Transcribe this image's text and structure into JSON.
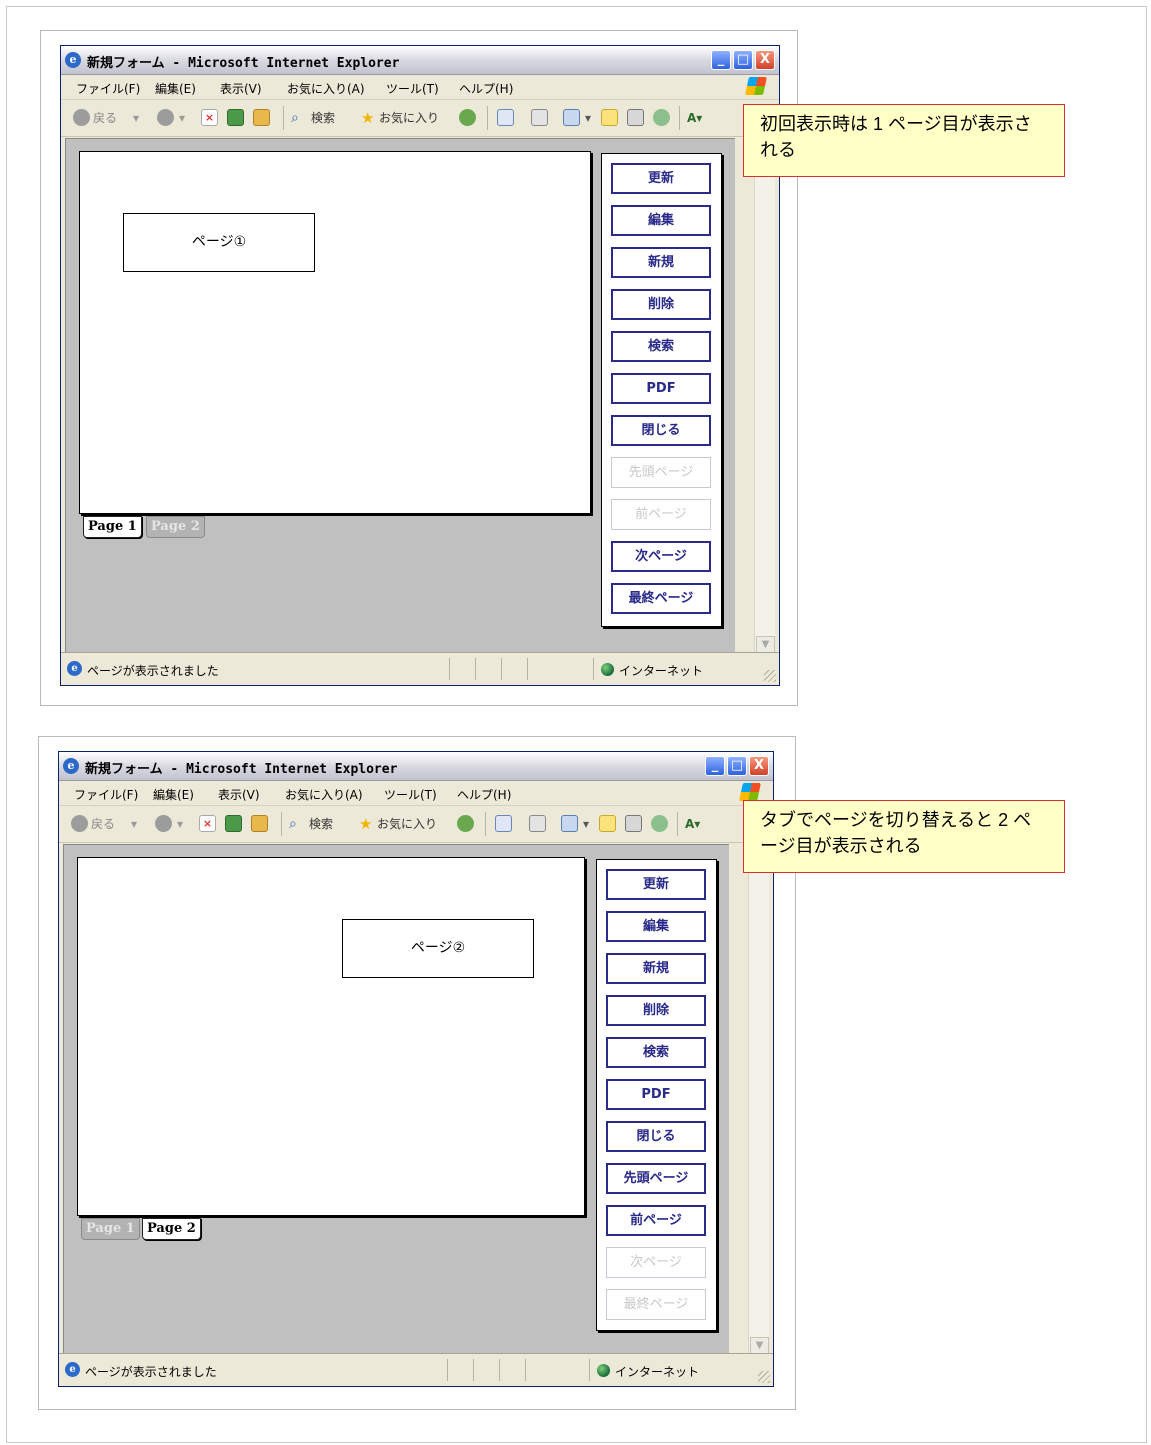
{
  "window": {
    "title": "新規フォーム - Microsoft Internet Explorer",
    "icon": "ie-icon",
    "controls": [
      "_",
      "□",
      "X"
    ]
  },
  "menu": [
    "ファイル(F)",
    "編集(E)",
    "表示(V)",
    "お気に入り(A)",
    "ツール(T)",
    "ヘルプ(H)"
  ],
  "toolbar": {
    "back": "戻る",
    "search": "検索",
    "favorites": "お気に入り"
  },
  "status": {
    "text": "ページが表示されました",
    "zone": "インターネット"
  },
  "tabs": [
    "Page 1",
    "Page 2"
  ],
  "buttons": [
    "更新",
    "編集",
    "新規",
    "削除",
    "検索",
    "PDF",
    "閉じる",
    "先頭ページ",
    "前ページ",
    "次ページ",
    "最終ページ"
  ],
  "screens": [
    {
      "page_label": "ページ①",
      "active_tab": "Page 1",
      "disabled_buttons": [
        "先頭ページ",
        "前ページ"
      ],
      "callout": "初回表示時は 1 ページ目が表示される"
    },
    {
      "page_label": "ページ②",
      "active_tab": "Page 2",
      "disabled_buttons": [
        "次ページ",
        "最終ページ"
      ],
      "callout": "タブでページを切り替えると 2 ページ目が表示される"
    }
  ],
  "colors": {
    "button_border": "#2a2a8a",
    "callout_bg": "#ffffc6",
    "callout_border": "#d93030",
    "form_bg": "#c0c0c0"
  }
}
